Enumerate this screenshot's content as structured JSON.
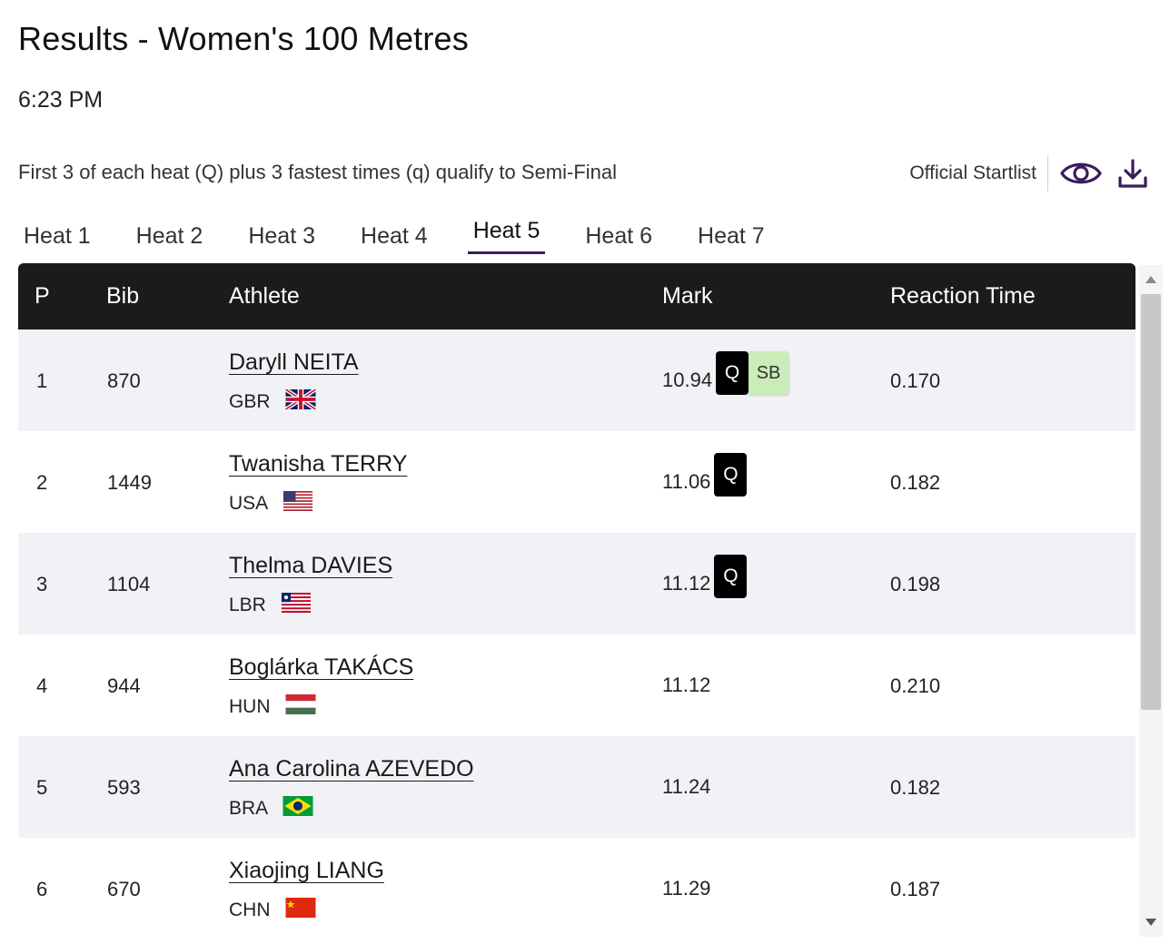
{
  "header": {
    "title": "Results - Women's 100 Metres",
    "time": "6:23 PM",
    "qualification_note": "First 3 of each heat (Q) plus 3 fastest times (q) qualify to Semi-Final",
    "startlist_label": "Official Startlist"
  },
  "icons": {
    "view": "eye-icon",
    "download": "download-icon"
  },
  "tabs": [
    {
      "label": "Heat 1",
      "active": false
    },
    {
      "label": "Heat 2",
      "active": false
    },
    {
      "label": "Heat 3",
      "active": false
    },
    {
      "label": "Heat 4",
      "active": false
    },
    {
      "label": "Heat 5",
      "active": true
    },
    {
      "label": "Heat 6",
      "active": false
    },
    {
      "label": "Heat 7",
      "active": false
    }
  ],
  "table": {
    "columns": {
      "p": "P",
      "bib": "Bib",
      "athlete": "Athlete",
      "mark": "Mark",
      "reaction": "Reaction Time"
    },
    "rows": [
      {
        "p": "1",
        "bib": "870",
        "name": "Daryll NEITA",
        "country": "GBR",
        "flag": "gbr-flag",
        "mark": "10.94",
        "q": "Q",
        "sb": "SB",
        "reaction": "0.170"
      },
      {
        "p": "2",
        "bib": "1449",
        "name": "Twanisha TERRY",
        "country": "USA",
        "flag": "usa-flag",
        "mark": "11.06",
        "q": "Q",
        "sb": "",
        "reaction": "0.182"
      },
      {
        "p": "3",
        "bib": "1104",
        "name": "Thelma DAVIES",
        "country": "LBR",
        "flag": "lbr-flag",
        "mark": "11.12",
        "q": "Q",
        "sb": "",
        "reaction": "0.198"
      },
      {
        "p": "4",
        "bib": "944",
        "name": "Boglárka TAKÁCS",
        "country": "HUN",
        "flag": "hun-flag",
        "mark": "11.12",
        "q": "",
        "sb": "",
        "reaction": "0.210"
      },
      {
        "p": "5",
        "bib": "593",
        "name": "Ana Carolina AZEVEDO",
        "country": "BRA",
        "flag": "bra-flag",
        "mark": "11.24",
        "q": "",
        "sb": "",
        "reaction": "0.182"
      },
      {
        "p": "6",
        "bib": "670",
        "name": "Xiaojing LIANG",
        "country": "CHN",
        "flag": "chn-flag",
        "mark": "11.29",
        "q": "",
        "sb": "",
        "reaction": "0.187"
      }
    ]
  },
  "colors": {
    "header_bg": "#1b1b1b",
    "row_shade": "#f1f2f6",
    "accent": "#3b1d5c",
    "sb_badge": "#c9ecb9"
  }
}
